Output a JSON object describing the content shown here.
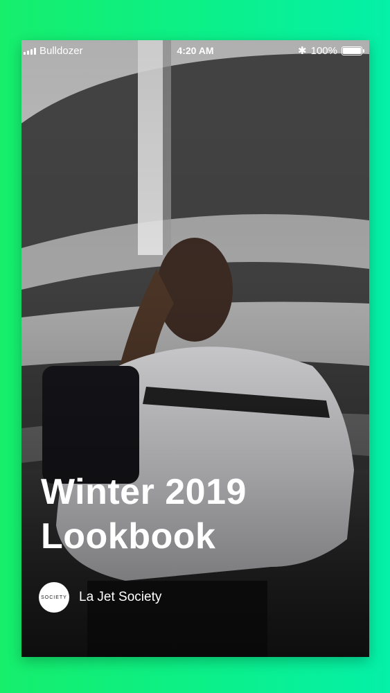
{
  "status_bar": {
    "carrier": "Bulldozer",
    "time": "4:20 AM",
    "battery_percent": "100%",
    "battery_level": 1.0,
    "signal_bars": 4,
    "bluetooth_icon": "bluetooth-icon"
  },
  "story": {
    "title_line1": "Winter 2019",
    "title_line2": "Lookbook",
    "brand_name": "La Jet Society",
    "brand_logo_text": "SOCIETY"
  },
  "colors": {
    "background_gradient_start": "#16ee6c",
    "background_gradient_end": "#05f0a8",
    "text": "#ffffff"
  }
}
